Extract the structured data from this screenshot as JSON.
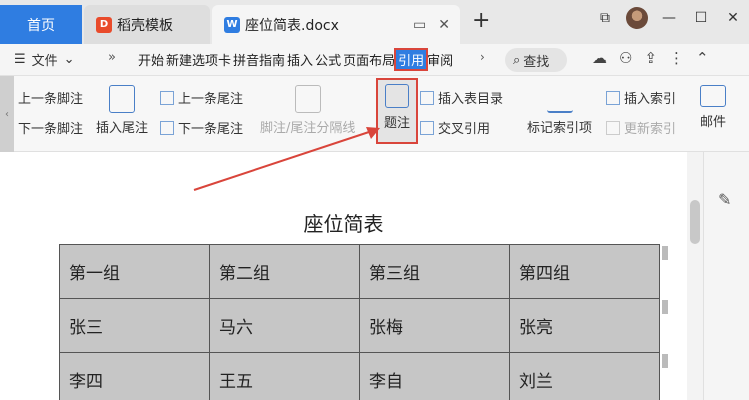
{
  "tabs": {
    "home": "首页",
    "template": "稻壳模板",
    "document": "座位简表.docx"
  },
  "menu": {
    "file": "文件",
    "tabs": [
      "开始",
      "新建选项卡",
      "拼音指南",
      "插入",
      "公式",
      "页面布局",
      "引用",
      "审阅"
    ],
    "search": "查找"
  },
  "ribbon": {
    "prev_footnote": "上一条脚注",
    "next_footnote": "下一条脚注",
    "insert_endnote": "插入尾注",
    "prev_endnote": "上一条尾注",
    "next_endnote": "下一条尾注",
    "separator": "脚注/尾注分隔线",
    "caption": "题注",
    "insert_toc_table": "插入表目录",
    "cross_ref": "交叉引用",
    "mark_index": "标记索引项",
    "insert_index": "插入索引",
    "update_index": "更新索引",
    "mail": "邮件"
  },
  "document": {
    "title": "座位简表",
    "table": [
      [
        "第一组",
        "第二组",
        "第三组",
        "第四组"
      ],
      [
        "张三",
        "马六",
        "张梅",
        "张亮"
      ],
      [
        "李四",
        "王五",
        "李自",
        "刘兰"
      ]
    ]
  },
  "colors": {
    "accent": "#2f7de1",
    "highlight": "#d9453b"
  }
}
